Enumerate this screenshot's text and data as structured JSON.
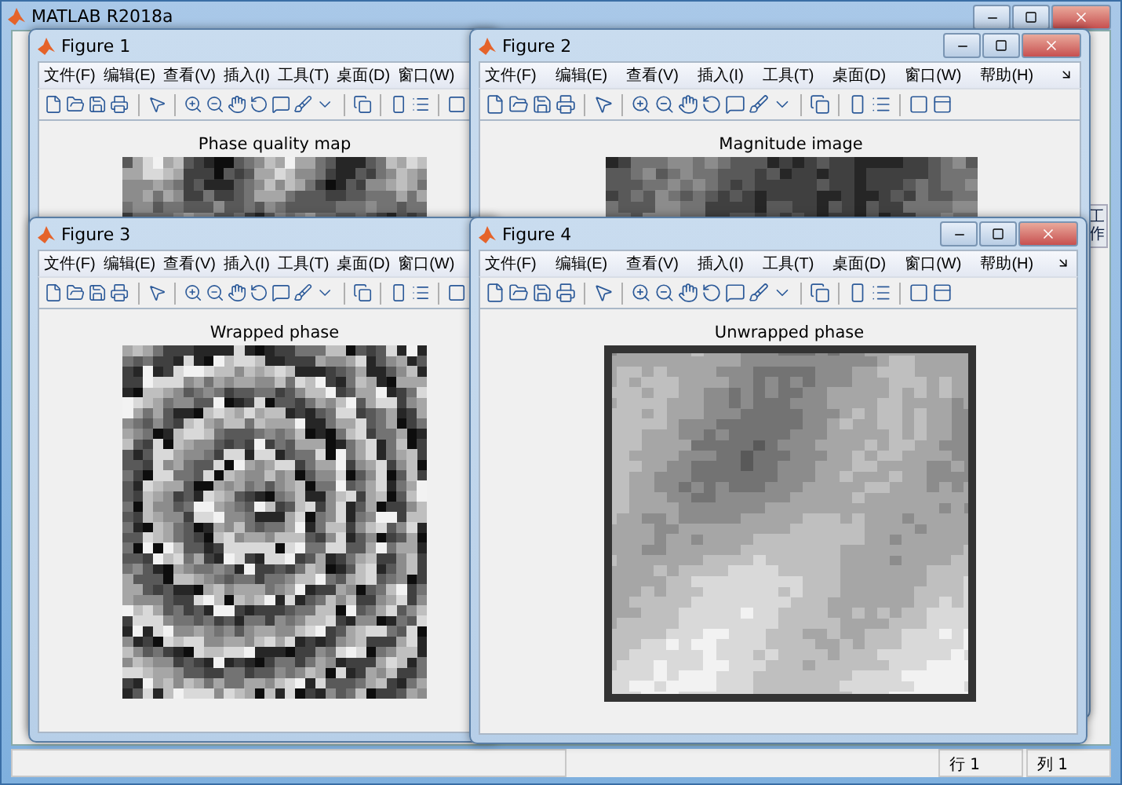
{
  "main_window": {
    "title": "MATLAB R2018a"
  },
  "side_tab": {
    "label": "工作"
  },
  "figures": [
    {
      "title": "Figure 1",
      "menu": [
        "文件(F)",
        "编辑(E)",
        "查看(V)",
        "插入(I)",
        "工具(T)",
        "桌面(D)",
        "窗口(W)"
      ],
      "axes_title": "Phase quality map"
    },
    {
      "title": "Figure 2",
      "menu": [
        "文件(F)",
        "编辑(E)",
        "查看(V)",
        "插入(I)",
        "工具(T)",
        "桌面(D)",
        "窗口(W)",
        "帮助(H)"
      ],
      "axes_title": "Magnitude image"
    },
    {
      "title": "Figure 3",
      "menu": [
        "文件(F)",
        "编辑(E)",
        "查看(V)",
        "插入(I)",
        "工具(T)",
        "桌面(D)",
        "窗口(W)"
      ],
      "axes_title": "Wrapped phase"
    },
    {
      "title": "Figure 4",
      "menu": [
        "文件(F)",
        "编辑(E)",
        "查看(V)",
        "插入(I)",
        "工具(T)",
        "桌面(D)",
        "窗口(W)",
        "帮助(H)"
      ],
      "axes_title": "Unwrapped phase"
    }
  ],
  "status_bar": {
    "row": "行 1",
    "column": "列 1"
  }
}
